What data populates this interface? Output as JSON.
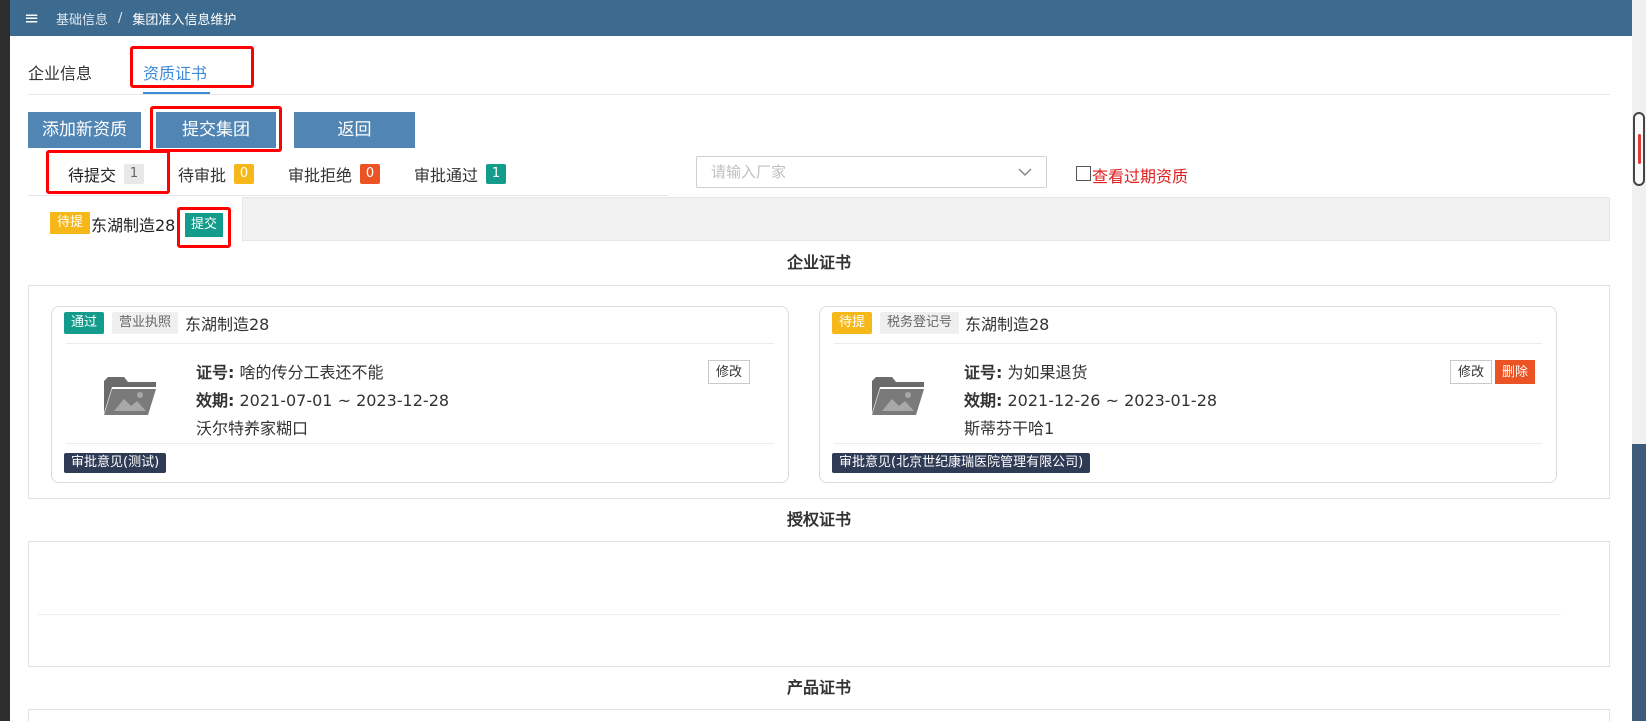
{
  "breadcrumb": {
    "menu_icon": "hamburger-icon",
    "level1": "基础信息",
    "separator": "/",
    "level2": "集团准入信息维护"
  },
  "main_tabs": [
    {
      "label": "企业信息",
      "active": false
    },
    {
      "label": "资质证书",
      "active": true
    }
  ],
  "toolbar": {
    "add_label": "添加新资质",
    "submit_label": "提交集团",
    "back_label": "返回"
  },
  "status_tabs": [
    {
      "label": "待提交",
      "count": "1"
    },
    {
      "label": "待审批",
      "count": "0"
    },
    {
      "label": "审批拒绝",
      "count": "0"
    },
    {
      "label": "审批通过",
      "count": "1"
    }
  ],
  "filter": {
    "search_placeholder": "请输入厂家",
    "search_value": "",
    "expired_label": "查看过期资质",
    "expired_checked": false
  },
  "supplier_tab": {
    "status": "待提",
    "name": "东湖制造28",
    "submit_label": "提交"
  },
  "sections": {
    "enterprise": "企业证书",
    "authorization": "授权证书",
    "product": "产品证书"
  },
  "cards": [
    {
      "status": "通过",
      "type": "营业执照",
      "company": "东湖制造28",
      "cert_no_label": "证号:",
      "cert_no": "啥的传分工表还不能",
      "validity_label": "效期:",
      "validity": "2021-07-01 ~ 2023-12-28",
      "note": "沃尔特养家糊口",
      "edit_label": "修改",
      "opinion": "审批意见(测试)"
    },
    {
      "status": "待提",
      "type": "税务登记号",
      "company": "东湖制造28",
      "cert_no_label": "证号:",
      "cert_no": "为如果退货",
      "validity_label": "效期:",
      "validity": "2021-12-26 ~ 2023-01-28",
      "note": "斯蒂芬干哈1",
      "edit_label": "修改",
      "delete_label": "删除",
      "opinion": "审批意见(北京世纪康瑞医院管理有限公司)"
    }
  ],
  "colors": {
    "header": "#3d6a8f",
    "button": "#5085b4",
    "link": "#3d8bd9",
    "pass": "#139b8b",
    "pending": "#f6b718",
    "danger": "#ec5324",
    "highlight": "#ff0000"
  }
}
